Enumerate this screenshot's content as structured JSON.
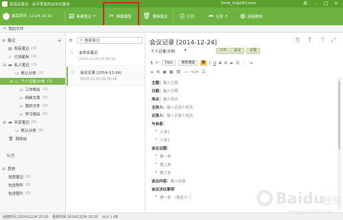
{
  "window": {
    "title": "有道云笔记 - 由不丢失的云中记事本",
    "user": "think_to@163.com",
    "controls": {
      "settings_icon": "gear-icon",
      "minimize_icon": "minimize-icon",
      "maximize_icon": "maximize-icon",
      "close_icon": "close-icon"
    }
  },
  "toolbar": {
    "sync_label": "最后同步: 12-24 20:31",
    "new_note": "新建笔记",
    "screenshot": "屏幕截图",
    "delete_note": "删除笔记",
    "print": "打印",
    "share": "分享",
    "connect": "连接微信"
  },
  "breadcrumb": "我的文件",
  "sidebar": {
    "sections": {
      "notes": "笔记",
      "tags": "标签",
      "other": "其他"
    },
    "items": [
      {
        "label": "所有笔记",
        "count": "(3)"
      },
      {
        "label": "已加星标",
        "count": "(0)"
      },
      {
        "label": "私人笔记",
        "count": "(3)"
      },
      {
        "label": "默认分类",
        "count": "(2)"
      },
      {
        "label": "个人记事/文档",
        "count": "(1)"
      },
      {
        "label": "工作相关",
        "count": "(0)"
      },
      {
        "label": "网络文章",
        "count": "(0)"
      },
      {
        "label": "我的文件",
        "count": "(0)"
      },
      {
        "label": "学习相关",
        "count": "(0)"
      },
      {
        "label": "共享笔记",
        "count": "(0)"
      },
      {
        "label": "默认分类",
        "count": "(0)"
      },
      {
        "label": "回收站",
        "count": ""
      }
    ],
    "other_items": [
      "加密笔记",
      "包含附件",
      "包含图片"
    ],
    "other_counts": [
      "(0)",
      "(0)",
      "(0)"
    ]
  },
  "notelist": {
    "search_placeholder": "搜索笔记",
    "notes": [
      {
        "title": "未命名笔记",
        "date": "2014-12-24 20:30:14"
      },
      {
        "title": "会议记录 [2014-12-24]",
        "date": "2014-12-24 20:30:14"
      }
    ]
  },
  "editor": {
    "title": "会议记录 [2014-12-24]",
    "notebook": "个人记事/文档",
    "tags": [
      "工作",
      "会议",
      "记录"
    ],
    "font_size": "14px",
    "font_family": "微软雅黑",
    "lines": [
      {
        "k": "主题：",
        "v": "输入主题"
      },
      {
        "k": "日期：",
        "v": "输入日期"
      },
      {
        "k": "地点：",
        "v": "输入地点"
      },
      {
        "k": "主持人：",
        "v": "输入主持人姓名"
      },
      {
        "k": "记录人：",
        "v": "输入记录人姓名"
      },
      {
        "k": "与会者：",
        "v": ""
      },
      {
        "bullet": "人员1"
      },
      {
        "bullet": "人员2"
      },
      {
        "k": "会议议题：",
        "v": ""
      },
      {
        "bullet": "第一条"
      },
      {
        "bullet": "第二条"
      },
      {
        "bullet": "第三条"
      },
      {
        "k": "会议内容：",
        "v": "输入内容"
      },
      {
        "k": "会议决议事项",
        "v": ""
      },
      {
        "bullet": "第一条 （责任人：）"
      }
    ]
  },
  "statusbar": {
    "created": "创建时间 2014/12/24 20:30",
    "updated": "更新时间 2014/12/24 20:30",
    "size": "大小 1 KB"
  },
  "watermark": {
    "text": "Baidu",
    "sub": "经验",
    "url": "jingyan.baidu.com"
  }
}
